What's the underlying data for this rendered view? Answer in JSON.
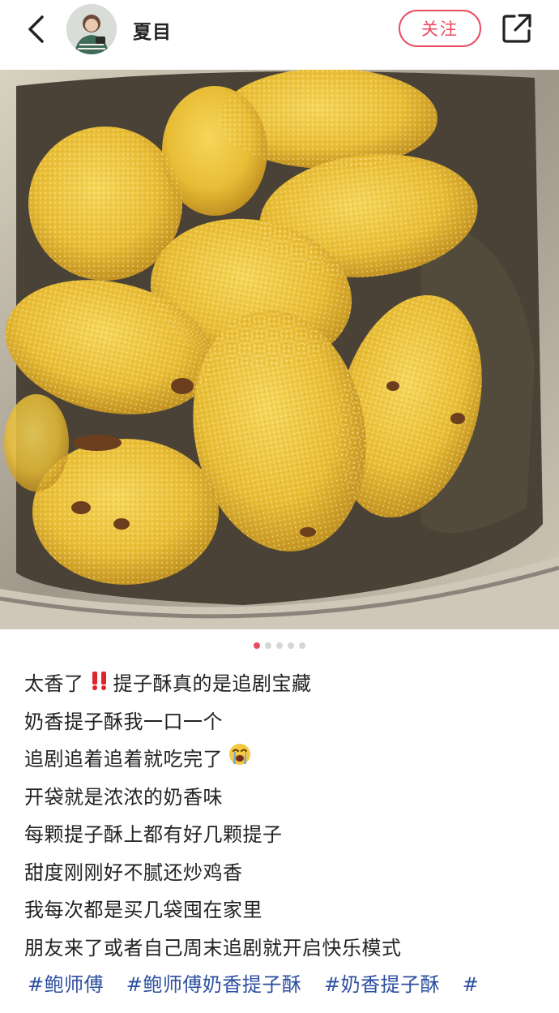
{
  "header": {
    "author_name": "夏目",
    "follow_label": "关注"
  },
  "icons": {
    "back": "chevron-left-icon",
    "share": "share-icon",
    "double_exclamation": "double-exclamation-icon",
    "crying": "loudly-crying-face-icon"
  },
  "carousel": {
    "total": 5,
    "active_index": 0
  },
  "post": {
    "lines": [
      "太香了",
      "提子酥真的是追剧宝藏",
      "奶香提子酥我一口一个",
      "追剧追着追着就吃完了",
      "开袋就是浓浓的奶香味",
      "每颗提子酥上都有好几颗提子",
      "甜度刚刚好不腻还炒鸡香",
      "我每次都是买几袋囤在家里",
      "朋友来了或者自己周末追剧就开启快乐模式"
    ],
    "tags": [
      "#鲍师傅",
      "#鲍师傅奶香提子酥",
      "#奶香提子酥",
      "#"
    ]
  },
  "colors": {
    "accent": "#e84a5f",
    "tag": "#2d4fa0"
  }
}
